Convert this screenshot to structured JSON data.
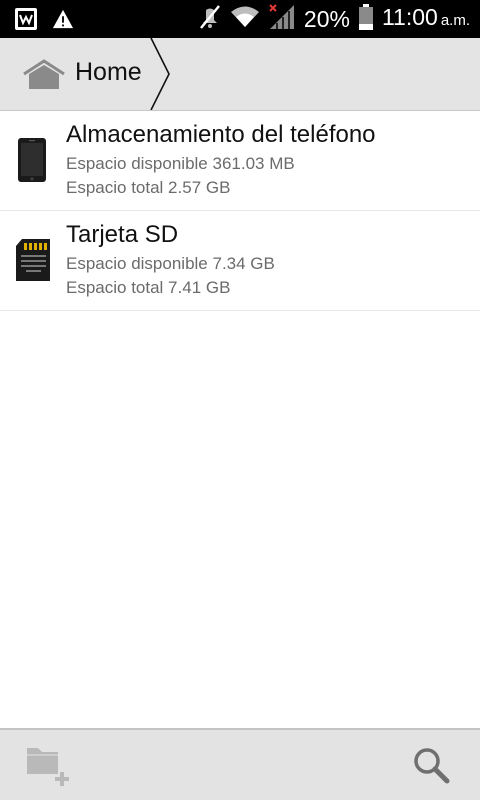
{
  "status_bar": {
    "icons_left": [
      "notification-app-icon",
      "warning-icon"
    ],
    "icons_right": [
      "mute-icon",
      "wifi-icon",
      "signal-icon",
      "battery-icon"
    ],
    "battery": "20%",
    "time": "11:00",
    "ampm": "a.m."
  },
  "breadcrumb": {
    "home_label": "Home",
    "icon": "home-icon"
  },
  "storage": {
    "items": [
      {
        "title": "Almacenamiento del teléfono",
        "available": "Espacio disponible 361.03 MB",
        "total": "Espacio total 2.57 GB",
        "icon": "phone-icon"
      },
      {
        "title": "Tarjeta SD",
        "available": "Espacio disponible 7.34 GB",
        "total": "Espacio total 7.41 GB",
        "icon": "sd-card-icon"
      }
    ]
  },
  "bottom_bar": {
    "actions": [
      "new-folder-icon",
      "search-icon"
    ]
  },
  "colors": {
    "status_bar_bg": "#000000",
    "header_bg": "#e4e4e4",
    "bottom_bar_bg": "#e3e3e3",
    "secondary_text": "#6b6b6b"
  }
}
